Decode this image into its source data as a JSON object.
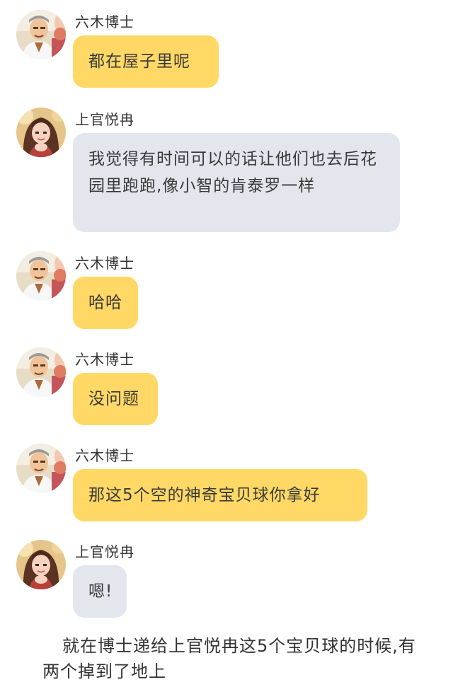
{
  "messages": [
    {
      "sender": "六木博士",
      "text": "都在屋子里呢",
      "bubble_color": "#ffd865",
      "avatar": "oak-avatar-icon"
    },
    {
      "sender": "上官悦冉",
      "text": "我觉得有时间可以的话让他们也去后花园里跑跑,像小智的肯泰罗一样",
      "bubble_color": "#e3e6ec",
      "avatar": "girl-avatar-icon"
    },
    {
      "sender": "六木博士",
      "text": "哈哈",
      "bubble_color": "#ffd865",
      "avatar": "oak-avatar-icon"
    },
    {
      "sender": "六木博士",
      "text": "没问题",
      "bubble_color": "#ffd865",
      "avatar": "oak-avatar-icon"
    },
    {
      "sender": "六木博士",
      "text": "那这5个空的神奇宝贝球你拿好",
      "bubble_color": "#ffd865",
      "avatar": "oak-avatar-icon"
    },
    {
      "sender": "上官悦冉",
      "text": "嗯!",
      "bubble_color": "#e3e6ec",
      "avatar": "girl-avatar-icon"
    }
  ],
  "caption": "就在博士递给上官悦冉这5个宝贝球的时候,有两个掉到了地上"
}
